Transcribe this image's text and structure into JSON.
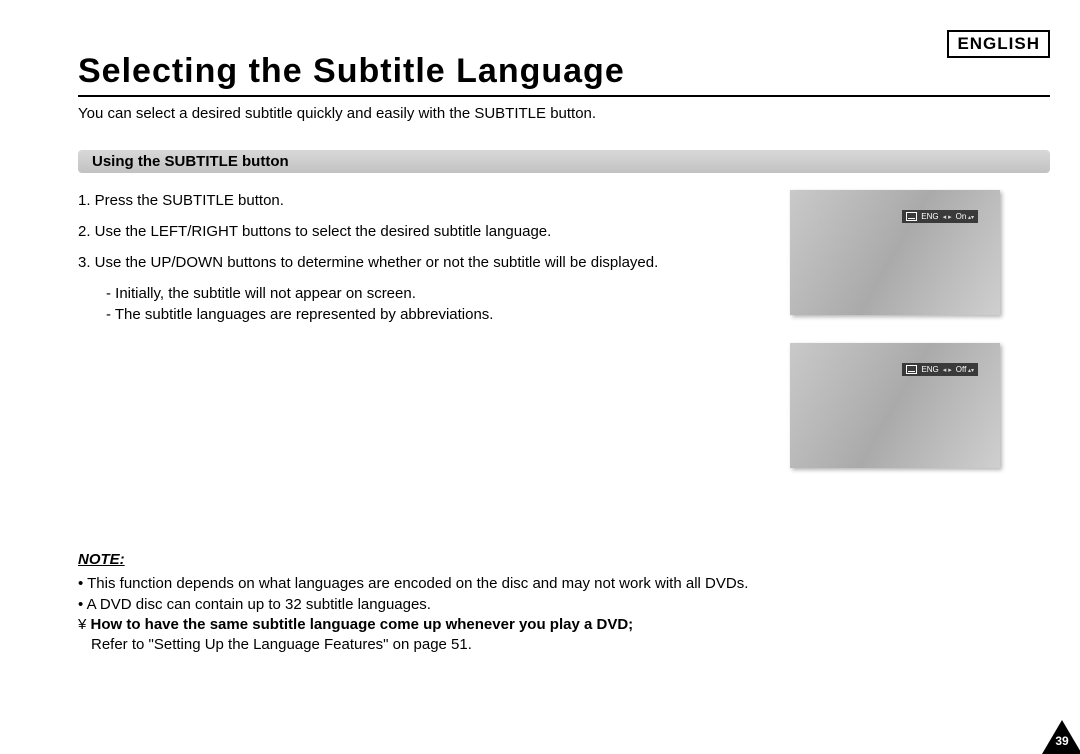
{
  "header": {
    "language_label": "ENGLISH",
    "title": "Selecting the Subtitle Language",
    "intro": "You can select a desired subtitle quickly and easily with the SUBTITLE button."
  },
  "section": {
    "bar_title": "Using the SUBTITLE button",
    "steps": {
      "s1": "1. Press the SUBTITLE button.",
      "s2": "2. Use the LEFT/RIGHT buttons to select the desired subtitle language.",
      "s3": "3. Use the UP/DOWN buttons to determine whether or not the subtitle will be displayed.",
      "s3a": "- Initially, the subtitle will not appear on screen.",
      "s3b": "- The subtitle languages are represented by abbreviations."
    }
  },
  "osd": {
    "screen1": {
      "lang": "ENG",
      "state": "On"
    },
    "screen2": {
      "lang": "ENG",
      "state": "Off"
    }
  },
  "note": {
    "title": "NOTE:",
    "b1": "• This function depends on what languages are encoded on the disc and may not work with all DVDs.",
    "b2": "• A DVD disc can contain up to 32 subtitle languages.",
    "howto_prefix": "¥ ",
    "howto": "How to have the same subtitle language come up whenever you play a DVD;",
    "refer": "Refer to \"Setting Up the Language Features\" on page 51."
  },
  "page_number": "39"
}
